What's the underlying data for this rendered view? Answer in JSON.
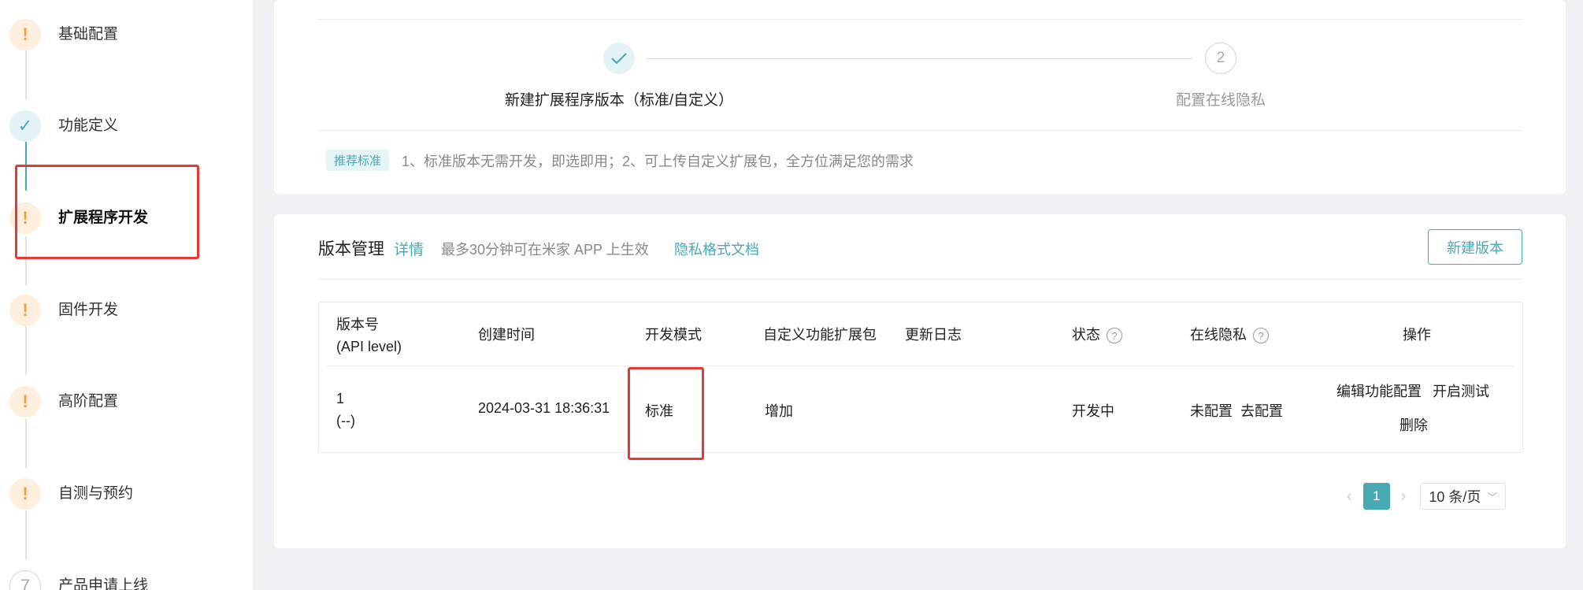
{
  "sidebar": {
    "steps": [
      {
        "label": "基础配置",
        "marker": "!",
        "state": "warn"
      },
      {
        "label": "功能定义",
        "marker": "✓",
        "state": "done"
      },
      {
        "label": "扩展程序开发",
        "marker": "!",
        "state": "warn-active"
      },
      {
        "label": "固件开发",
        "marker": "!",
        "state": "warn"
      },
      {
        "label": "高阶配置",
        "marker": "!",
        "state": "warn"
      },
      {
        "label": "自测与预约",
        "marker": "!",
        "state": "warn"
      },
      {
        "label": "产品申请上线",
        "marker": "7",
        "state": "number"
      }
    ]
  },
  "stepper": {
    "step1_label": "新建扩展程序版本（标准/自定义）",
    "step2_number": "2",
    "step2_label": "配置在线隐私"
  },
  "recommend": {
    "tag": "推荐标准",
    "text": "1、标准版本无需开发，即选即用；2、可上传自定义扩展包，全方位满足您的需求"
  },
  "version_mgmt": {
    "title": "版本管理",
    "detail_link": "详情",
    "note": "最多30分钟可在米家 APP 上生效",
    "privacy_doc_link": "隐私格式文档",
    "new_button": "新建版本"
  },
  "table": {
    "headers": {
      "version_line1": "版本号",
      "version_line2": "(API level)",
      "created": "创建时间",
      "mode": "开发模式",
      "ext_pkg": "自定义功能扩展包",
      "changelog": "更新日志",
      "status": "状态",
      "privacy": "在线隐私",
      "actions": "操作"
    },
    "row": {
      "version": "1",
      "api_level": "(--)",
      "created": "2024-03-31 18:36:31",
      "mode": "标准",
      "ext_pkg_action": "增加",
      "changelog": "",
      "status": "开发中",
      "privacy_status": "未配置",
      "privacy_action": "去配置",
      "action_edit": "编辑功能配置",
      "action_test": "开启测试",
      "action_delete": "删除"
    }
  },
  "pagination": {
    "current_page": "1",
    "page_size": "10 条/页"
  },
  "colors": {
    "accent": "#49a9b5",
    "warn": "#f0a040",
    "highlight": "#e53935"
  }
}
